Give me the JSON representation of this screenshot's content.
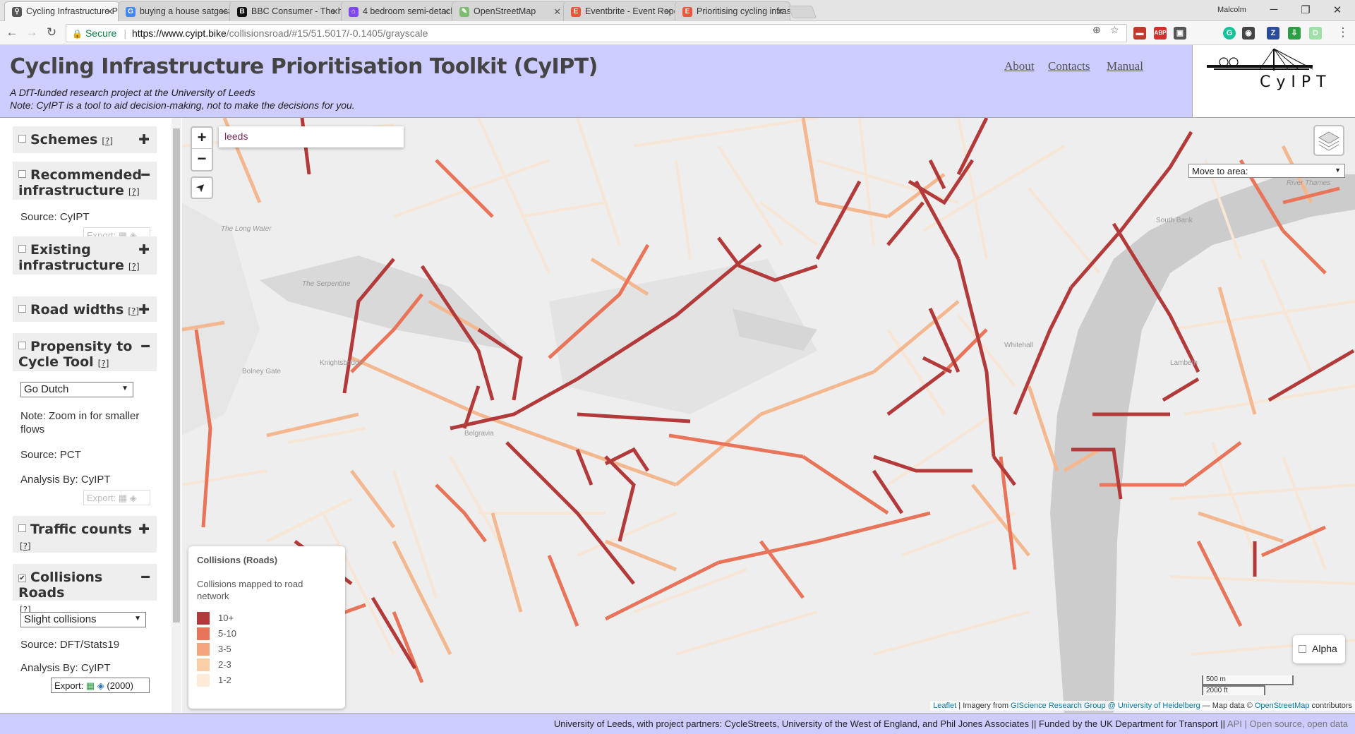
{
  "browser": {
    "tabs": [
      {
        "title": "Cycling Infrastructure Pri",
        "icon": "cyclestreets-icon",
        "color": "#555555",
        "active": true
      },
      {
        "title": "buying a house satges#",
        "icon": "google-icon",
        "color": "#4285f4",
        "active": false
      },
      {
        "title": "BBC Consumer - The hon",
        "icon": "bbc-icon",
        "color": "#111111",
        "active": false
      },
      {
        "title": "4 bedroom semi-detache",
        "icon": "zoopla-icon",
        "color": "#8046f1",
        "active": false
      },
      {
        "title": "OpenStreetMap",
        "icon": "osm-icon",
        "color": "#7ebc6f",
        "active": false
      },
      {
        "title": "Eventbrite - Event Repor",
        "icon": "eventbrite-icon",
        "color": "#f05537",
        "active": false
      },
      {
        "title": "Prioritising cycling infras",
        "icon": "eventbrite-icon",
        "color": "#f05537",
        "active": false
      }
    ],
    "profile_name": "Malcolm",
    "secure_label": "Secure",
    "url_host": "https://www.cyipt.bike",
    "url_path": "/collisionsroad/#15/51.5017/-0.1405/grayscale",
    "extensions": [
      {
        "label": "▬",
        "color": "#c0392b"
      },
      {
        "label": "ABP",
        "color": "#d32f2f"
      },
      {
        "label": "▣",
        "color": "#555555"
      },
      {
        "label": "G",
        "color": "#15c39a"
      },
      {
        "label": "◉",
        "color": "#444444"
      },
      {
        "label": "Z",
        "color": "#2a4d9b"
      },
      {
        "label": "⇩",
        "color": "#2e9e44"
      },
      {
        "label": "D",
        "color": "#9ee0a6"
      }
    ]
  },
  "header": {
    "title": "Cycling Infrastructure Prioritisation Toolkit (CyIPT)",
    "subtitle_line1": "A DfT-funded research project at the University of Leeds",
    "subtitle_line2": "Note: CyIPT is a tool to aid decision-making, not to make the decisions for you.",
    "nav": {
      "about": "About",
      "contacts": "Contacts",
      "manual": "Manual"
    },
    "logo_text": "CyIPT"
  },
  "sidebar": {
    "help_label": "[?]",
    "schemes": {
      "label": "Schemes",
      "toggle": "✚"
    },
    "recommended": {
      "label_line1": "Recommended",
      "label_line2": "infrastructure",
      "toggle": "━",
      "source": "Source: CyIPT",
      "export_label": "Export:"
    },
    "existing": {
      "label_line1": "Existing",
      "label_line2": "infrastructure",
      "toggle": "✚"
    },
    "road_widths": {
      "label": "Road widths",
      "toggle": "✚"
    },
    "pct": {
      "label_line1": "Propensity to",
      "label_line2": "Cycle Tool",
      "toggle": "━",
      "select_value": "Go Dutch",
      "note": "Note: Zoom in for smaller flows",
      "source": "Source: PCT",
      "analysis": "Analysis By: CyIPT",
      "export_label": "Export:"
    },
    "traffic": {
      "label": "Traffic counts",
      "toggle": "✚"
    },
    "collisions": {
      "label": "Collisions Roads",
      "checked": "✔",
      "toggle": "━",
      "select_value": "Slight collisions",
      "source": "Source: DFT/Stats19",
      "analysis": "Analysis By: CyIPT",
      "export_label": "Export:",
      "export_count": "(2000)"
    }
  },
  "map": {
    "zoom_in": "+",
    "zoom_out": "−",
    "locate_icon": "➤",
    "search_value": "leeds",
    "move_to_area": "Move to area:",
    "alpha_label": "Alpha",
    "scale_metric": "500 m",
    "scale_imperial": "2000 ft",
    "attribution": {
      "leaflet": "Leaflet",
      "text1": " | Imagery from ",
      "giscience": "GIScience Research Group @ University of Heidelberg",
      "text2": " — Map data © ",
      "osm": "OpenStreetMap",
      "text3": " contributors"
    },
    "place_labels": [
      {
        "text": "The Long Water"
      },
      {
        "text": "The Serpentine"
      },
      {
        "text": "Bolney Gate"
      },
      {
        "text": "Knightsbridge"
      },
      {
        "text": "Belgravia"
      },
      {
        "text": "South Bank"
      },
      {
        "text": "Lambeth"
      },
      {
        "text": "River Thames"
      },
      {
        "text": "Whitehall"
      }
    ],
    "legend": {
      "title": "Collisions (Roads)",
      "description": "Collisions mapped to road network",
      "items": [
        {
          "label": "10+",
          "color": "#b33a3a"
        },
        {
          "label": "5-10",
          "color": "#e8755a"
        },
        {
          "label": "3-5",
          "color": "#f4a57e"
        },
        {
          "label": "2-3",
          "color": "#f9cfa8"
        },
        {
          "label": "1-2",
          "color": "#fdebd8"
        }
      ]
    }
  },
  "footer": {
    "text": "University of Leeds, with project partners: CycleStreets, University of the West of England, and Phil Jones Associates  ||  Funded by the UK Department for Transport  || ",
    "api": "API",
    "sep": " | ",
    "open": "Open source, open data"
  }
}
